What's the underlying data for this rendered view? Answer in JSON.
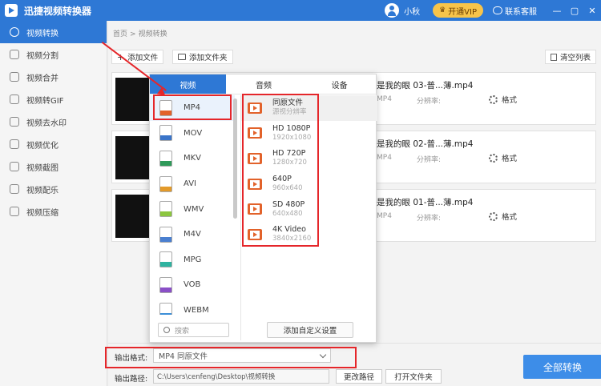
{
  "app": {
    "title": "迅捷视频转换器",
    "username": "小秋",
    "vip": "开通VIP",
    "service": "联系客服"
  },
  "window": {
    "min": "—",
    "max": "▢",
    "close": "✕"
  },
  "sidebar": {
    "items": [
      {
        "label": "视频转换"
      },
      {
        "label": "视频分割"
      },
      {
        "label": "视频合并"
      },
      {
        "label": "视频转GIF"
      },
      {
        "label": "视频去水印"
      },
      {
        "label": "视频优化"
      },
      {
        "label": "视频截图"
      },
      {
        "label": "视频配乐"
      },
      {
        "label": "视频压缩"
      }
    ]
  },
  "breadcrumb": {
    "home": "首页",
    "sep": ">",
    "current": "视频转换"
  },
  "toolbar": {
    "add_file": "添加文件",
    "add_folder": "添加文件夹",
    "clear": "清空列表"
  },
  "files": [
    {
      "name": "是我的眼 03-普...薄.mp4",
      "format": "MP4",
      "resolution": "分辨率:",
      "settings": "格式"
    },
    {
      "name": "是我的眼 02-普...薄.mp4",
      "format": "MP4",
      "resolution": "分辨率:",
      "settings": "格式"
    },
    {
      "name": "是我的眼 01-普...薄.mp4",
      "format": "MP4",
      "resolution": "分辨率:",
      "settings": "格式"
    }
  ],
  "popup": {
    "tabs": [
      {
        "label": "视频"
      },
      {
        "label": "音频"
      },
      {
        "label": "设备"
      }
    ],
    "formats": [
      {
        "label": "MP4",
        "tag": "MP4",
        "color": "#e2622a"
      },
      {
        "label": "MOV",
        "tag": "MOV",
        "color": "#3a74c9"
      },
      {
        "label": "MKV",
        "tag": "MKV",
        "color": "#2f9a5a"
      },
      {
        "label": "AVI",
        "tag": "AVI",
        "color": "#e39a2a"
      },
      {
        "label": "WMV",
        "tag": "WMV",
        "color": "#8cc63f"
      },
      {
        "label": "M4V",
        "tag": "M4V",
        "color": "#4a7fd0"
      },
      {
        "label": "MPG",
        "tag": "MPG",
        "color": "#2fb3a0"
      },
      {
        "label": "VOB",
        "tag": "VOB",
        "color": "#8a4fc7"
      },
      {
        "label": "WEBM",
        "tag": "WEBM",
        "color": "#3c8fd8"
      }
    ],
    "presets": [
      {
        "name": "同原文件",
        "res": "源视分辨率"
      },
      {
        "name": "HD 1080P",
        "res": "1920x1080"
      },
      {
        "name": "HD 720P",
        "res": "1280x720"
      },
      {
        "name": "640P",
        "res": "960x640"
      },
      {
        "name": "SD 480P",
        "res": "640x480"
      },
      {
        "name": "4K Video",
        "res": "3840x2160"
      }
    ],
    "search_placeholder": "搜索",
    "custom": "添加自定义设置"
  },
  "bottom": {
    "format_label": "输出格式:",
    "format_value": "MP4  同原文件",
    "path_label": "输出路径:",
    "path_value": "C:\\Users\\cenfeng\\Desktop\\视频转换",
    "change_path": "更改路径",
    "open_folder": "打开文件夹",
    "convert_all": "全部转换"
  },
  "colors": {
    "accent": "#2e78d5",
    "annotation": "#e5262a",
    "vip": "#f7c44a"
  }
}
